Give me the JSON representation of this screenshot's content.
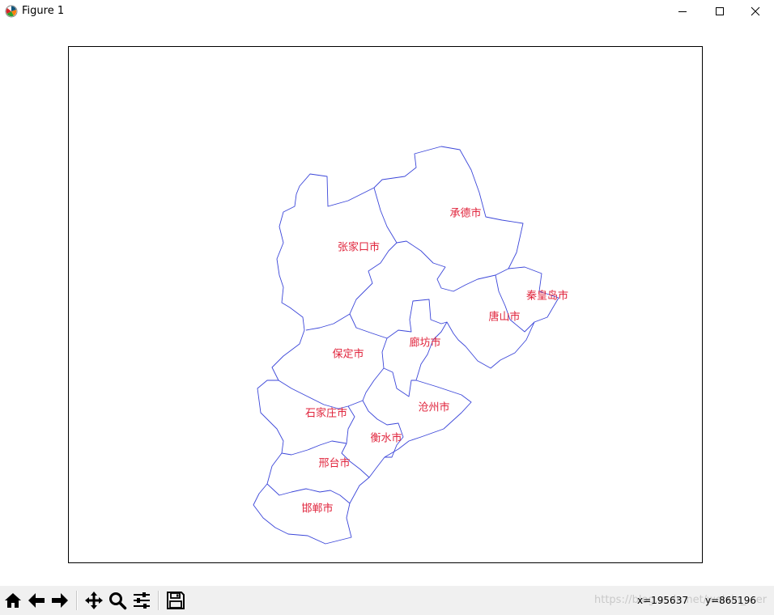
{
  "window": {
    "title": "Figure 1",
    "icons": [
      "matplotlib-icon",
      "minimize-icon",
      "maximize-icon",
      "close-icon"
    ]
  },
  "map": {
    "boundary_color": "#3b46d9",
    "label_color": "#e0243c",
    "regions": [
      {
        "id": "chengde",
        "label": "承德市"
      },
      {
        "id": "zhangjiakou",
        "label": "张家口市"
      },
      {
        "id": "qinhuangdao",
        "label": "秦皇岛市"
      },
      {
        "id": "tangshan",
        "label": "唐山市"
      },
      {
        "id": "langfang",
        "label": "廊坊市"
      },
      {
        "id": "baoding",
        "label": "保定市"
      },
      {
        "id": "cangzhou",
        "label": "沧州市"
      },
      {
        "id": "shijiazhuang",
        "label": "石家庄市"
      },
      {
        "id": "hengshui",
        "label": "衡水市"
      },
      {
        "id": "xingtai",
        "label": "邢台市"
      },
      {
        "id": "handan",
        "label": "邯郸市"
      }
    ]
  },
  "toolbar": {
    "buttons": [
      {
        "id": "home",
        "icon": "home-icon"
      },
      {
        "id": "back",
        "icon": "arrow-left-icon"
      },
      {
        "id": "forward",
        "icon": "arrow-right-icon"
      },
      {
        "id": "pan",
        "icon": "move-icon"
      },
      {
        "id": "zoom",
        "icon": "zoom-icon"
      },
      {
        "id": "configure",
        "icon": "sliders-icon"
      },
      {
        "id": "save",
        "icon": "save-icon"
      }
    ],
    "watermark": "https://blog.csdn.net/weixin_...er",
    "coord_x": "x=195637",
    "coord_y": "y=865196"
  }
}
